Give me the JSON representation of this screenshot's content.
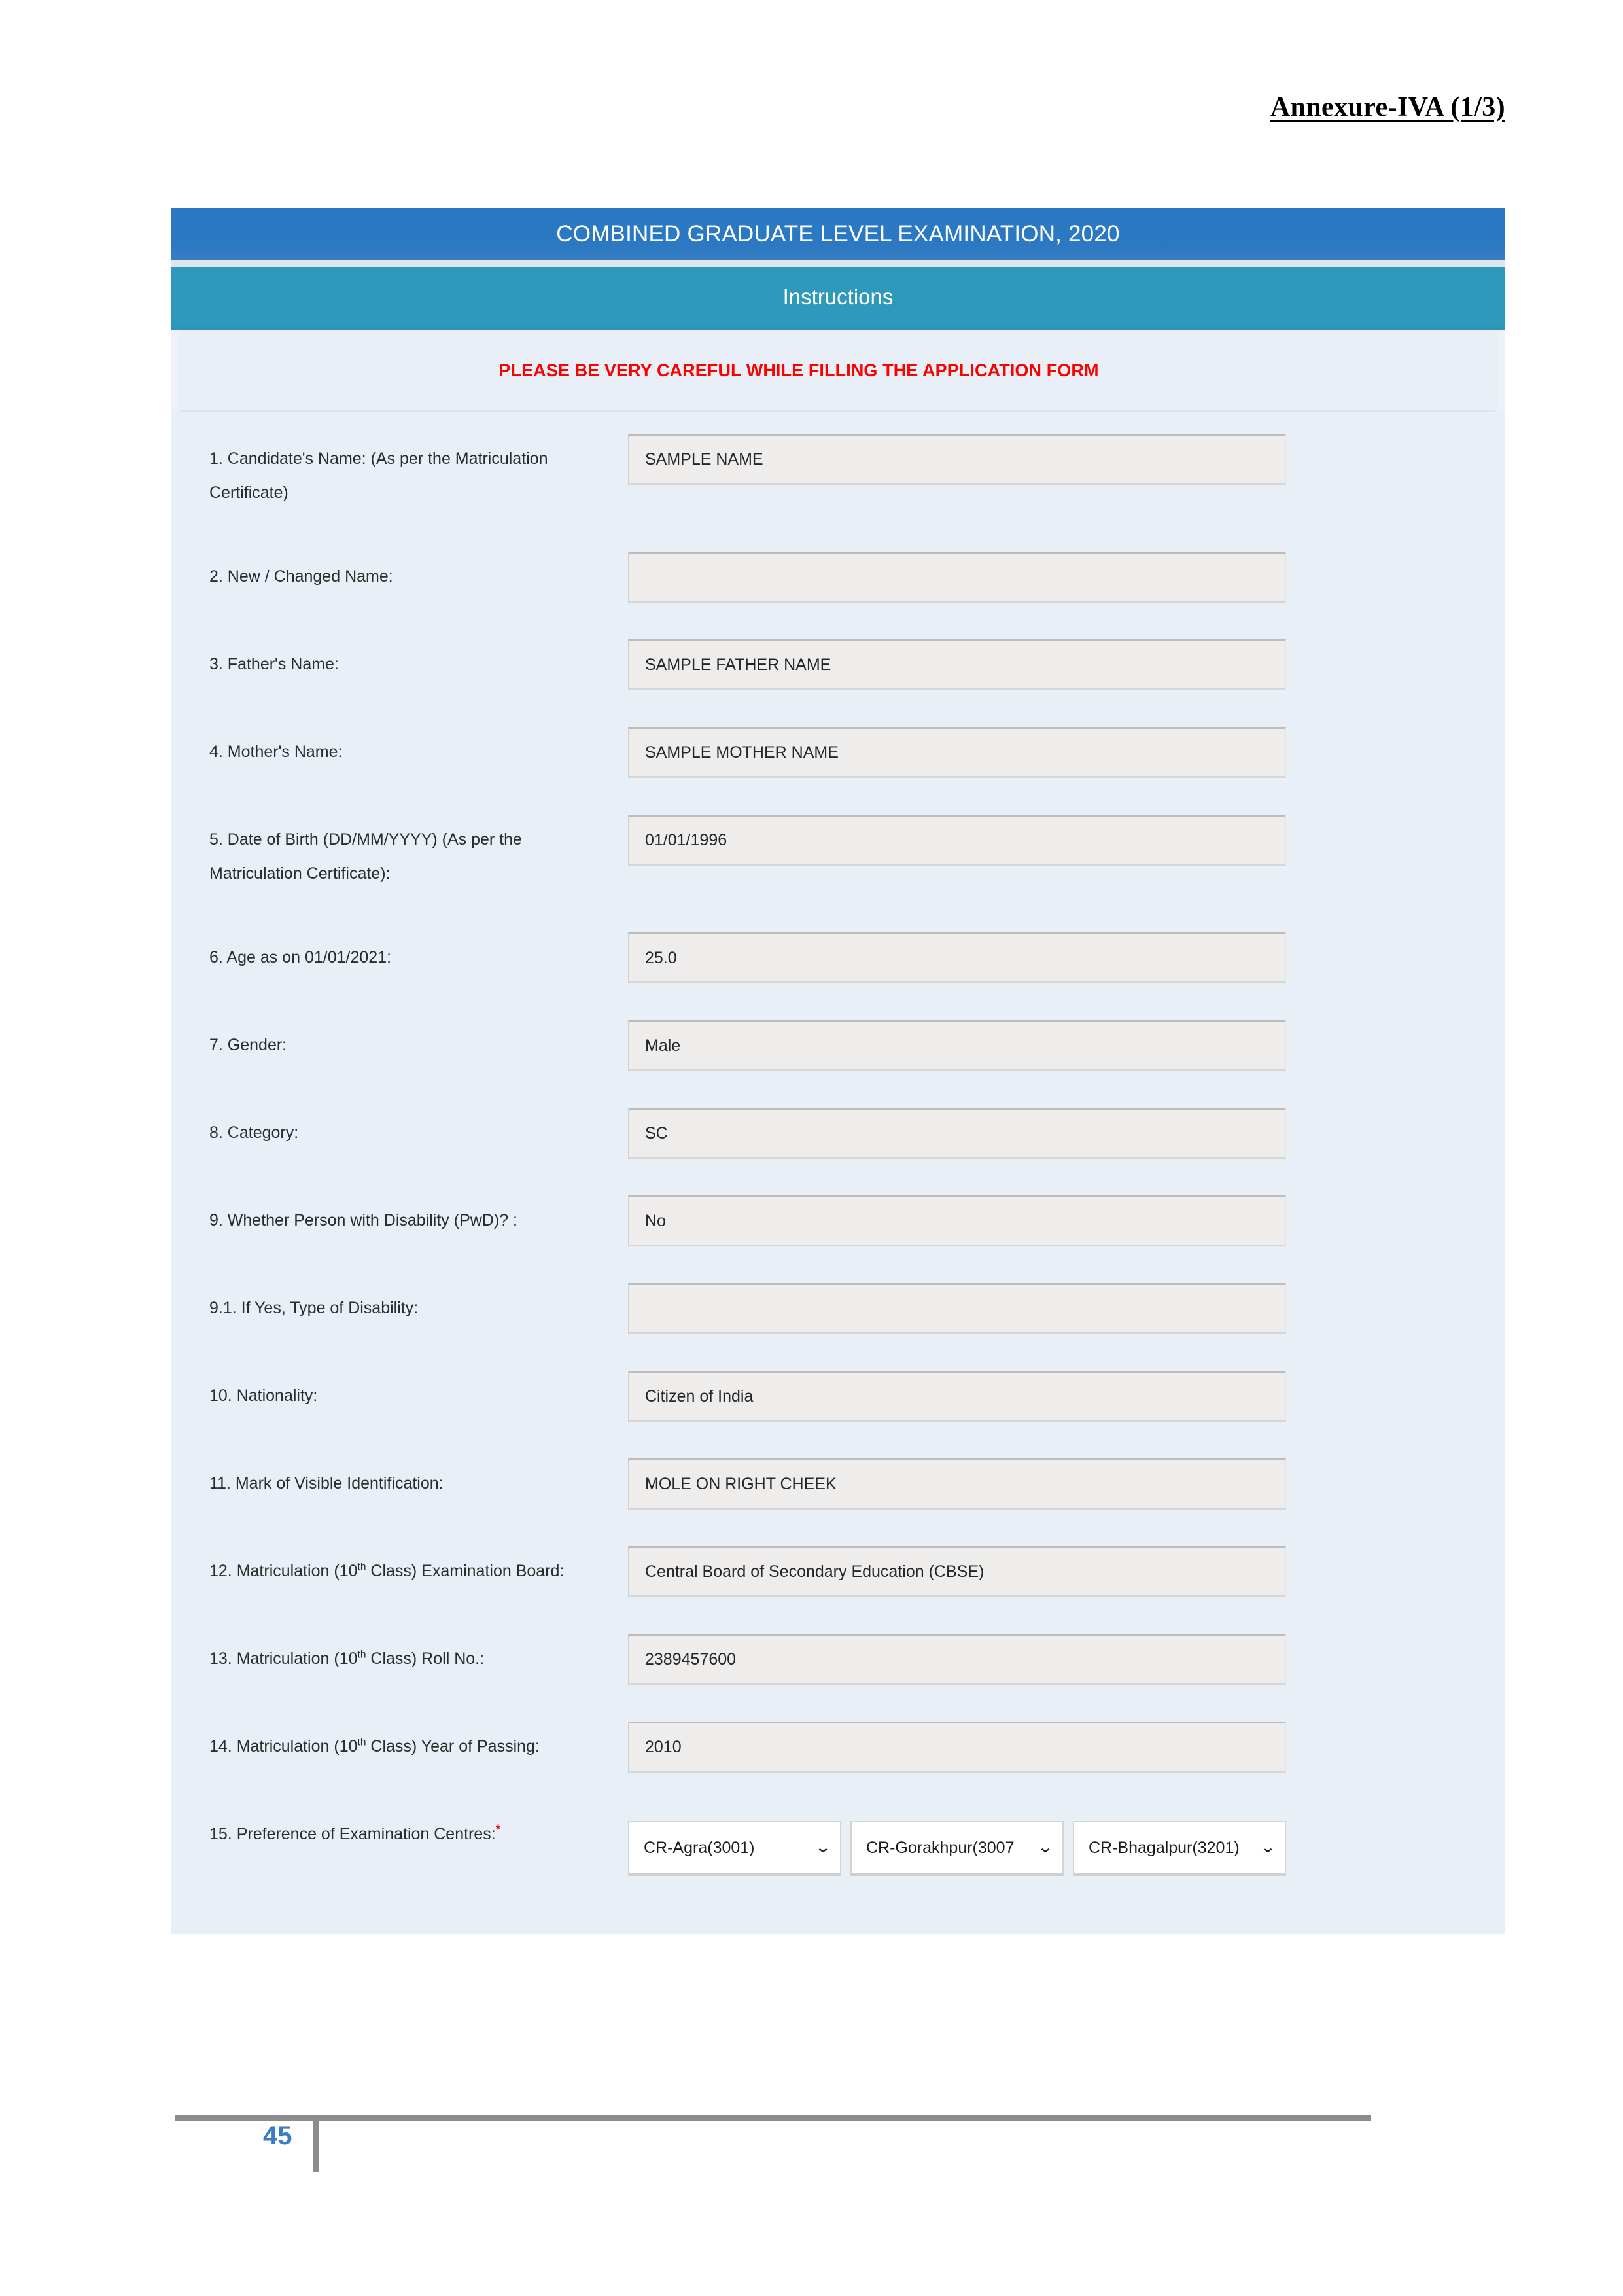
{
  "document": {
    "annexure_label": "Annexure-IVA (1/3)",
    "page_number": "45"
  },
  "header": {
    "title": "COMBINED GRADUATE LEVEL EXAMINATION, 2020",
    "subtitle": "Instructions",
    "warning": "PLEASE BE VERY CAREFUL WHILE FILLING THE APPLICATION FORM",
    "title_color": "#2b79c2",
    "subtitle_color": "#2f99bc",
    "warning_color": "#fe0000"
  },
  "form": {
    "fields": [
      {
        "number": "1.",
        "label": "1. Candidate's Name: (As per the Matriculation Certificate)",
        "value": "SAMPLE NAME"
      },
      {
        "number": "2.",
        "label": "2. New / Changed Name:",
        "value": ""
      },
      {
        "number": "3.",
        "label": "3. Father's Name:",
        "value": "SAMPLE FATHER NAME"
      },
      {
        "number": "4.",
        "label": "4. Mother's Name:",
        "value": "SAMPLE MOTHER NAME"
      },
      {
        "number": "5.",
        "label": "5. Date of Birth (DD/MM/YYYY) (As per the Matriculation Certificate):",
        "value": "01/01/1996"
      },
      {
        "number": "6.",
        "label": "6. Age as on 01/01/2021:",
        "value": "25.0"
      },
      {
        "number": "7.",
        "label": "7. Gender:",
        "value": "Male"
      },
      {
        "number": "8.",
        "label": "8. Category:",
        "value": "SC"
      },
      {
        "number": "9.",
        "label": "9. Whether Person with Disability (PwD)? :",
        "value": "No"
      },
      {
        "number": "9.1.",
        "label": "9.1. If Yes, Type of Disability:",
        "value": ""
      },
      {
        "number": "10.",
        "label": "10. Nationality:",
        "value": "Citizen of India"
      },
      {
        "number": "11.",
        "label": "11. Mark of Visible Identification:",
        "value": "MOLE ON RIGHT CHEEK"
      },
      {
        "number": "12.",
        "label_prefix": "12. Matriculation (10",
        "label_sup": "th",
        "label_suffix": " Class) Examination Board:",
        "value": "Central Board of Secondary Education (CBSE)"
      },
      {
        "number": "13.",
        "label_prefix": "13. Matriculation (10",
        "label_sup": "th",
        "label_suffix": " Class) Roll No.:",
        "value": "2389457600"
      },
      {
        "number": "14.",
        "label_prefix": "14. Matriculation (10",
        "label_sup": "th",
        "label_suffix": " Class) Year of Passing:",
        "value": "2010"
      }
    ],
    "centre_preference": {
      "label": "15. Preference of Examination Centres:",
      "required_marker": "*",
      "selects": [
        {
          "value": "CR-Agra(3001)"
        },
        {
          "value": "CR-Gorakhpur(3007"
        },
        {
          "value": "CR-Bhagalpur(3201)"
        }
      ],
      "chevron": "⌄"
    }
  }
}
